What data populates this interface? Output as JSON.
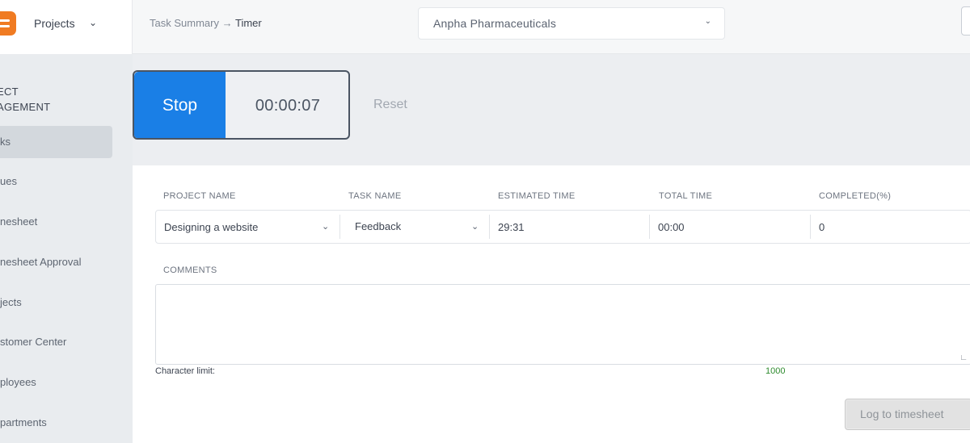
{
  "header": {
    "brand_label": "Projects",
    "brand_menu_icon": "chevron-down-icon",
    "breadcrumb": {
      "parent": "Task Summary",
      "separator": "→",
      "current": "Timer"
    },
    "company_select": {
      "value": "Anpha Pharmaceuticals",
      "icon": "chevron-down-icon"
    }
  },
  "sidebar": {
    "heading_line1": "ECT",
    "heading_line2": "AGEMENT",
    "items": [
      {
        "label": "ks",
        "active": true
      },
      {
        "label": "ues",
        "active": false
      },
      {
        "label": "nesheet",
        "active": false
      },
      {
        "label": "nesheet Approval",
        "active": false
      },
      {
        "label": "jects",
        "active": false
      },
      {
        "label": "stomer Center",
        "active": false
      },
      {
        "label": "ployees",
        "active": false
      },
      {
        "label": "partments",
        "active": false
      }
    ]
  },
  "timer": {
    "stop_label": "Stop",
    "elapsed": "00:00:07",
    "reset_label": "Reset"
  },
  "form": {
    "columns": [
      "PROJECT NAME",
      "TASK NAME",
      "ESTIMATED TIME",
      "TOTAL TIME",
      "COMPLETED(%)"
    ],
    "project_name": "Designing a website",
    "task_name": "Feedback",
    "estimated_time": "29:31",
    "total_time": "00:00",
    "completed": "0",
    "comments_label": "COMMENTS",
    "comments_value": "",
    "char_limit_label": "Character limit:",
    "char_limit_value": "1000",
    "log_button_label": "Log to timesheet"
  },
  "colors": {
    "accent_blue": "#1a7fe6",
    "logo_orange": "#f07b22",
    "char_limit_green": "#2e8b2e"
  }
}
